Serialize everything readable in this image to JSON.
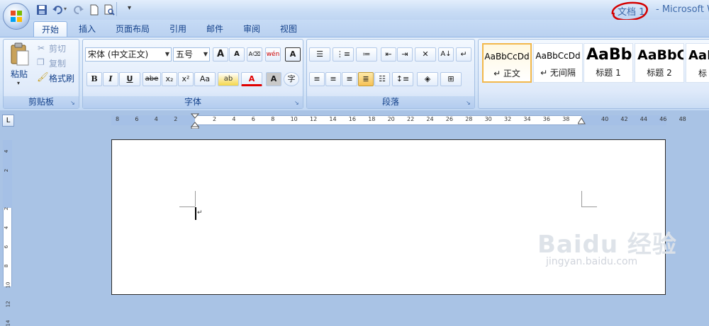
{
  "title_bar": {
    "document_name": "文档 1",
    "app_name": "- Microsoft W",
    "quick_access": [
      "save-icon",
      "undo-icon",
      "redo-icon",
      "new-icon",
      "print-preview-icon",
      "customize-qat-icon"
    ]
  },
  "tabs": [
    {
      "label": "开始",
      "active": true
    },
    {
      "label": "插入"
    },
    {
      "label": "页面布局"
    },
    {
      "label": "引用"
    },
    {
      "label": "邮件"
    },
    {
      "label": "审阅"
    },
    {
      "label": "视图"
    }
  ],
  "clipboard": {
    "paste_label": "粘贴",
    "cut_label": "剪切",
    "copy_label": "复制",
    "format_painter_label": "格式刷",
    "group_label": "剪贴板"
  },
  "font": {
    "font_name": "宋体 (中文正文)",
    "font_size": "五号",
    "grow_label": "A",
    "shrink_label": "A",
    "pinyin_label": "wén",
    "char_border_label": "A",
    "bold": "B",
    "italic": "I",
    "underline": "U",
    "strike": "abe",
    "subscript": "x₂",
    "superscript": "x²",
    "change_case": "Aa",
    "highlight": "ab",
    "font_color": "A",
    "char_shading": "A",
    "enclose": "字",
    "group_label": "字体"
  },
  "paragraph": {
    "group_label": "段落"
  },
  "styles": [
    {
      "sample": "AaBbCcDd",
      "name": "↵ 正文",
      "selected": true
    },
    {
      "sample": "AaBbCcDd",
      "name": "↵ 无间隔"
    },
    {
      "sample": "AaBb",
      "name": "标题 1"
    },
    {
      "sample": "AaBbC",
      "name": "标题 2"
    },
    {
      "sample": "AaB",
      "name": "标"
    }
  ],
  "ruler": {
    "tab_selector": "L",
    "ticks": [
      "8",
      "6",
      "4",
      "2",
      "",
      "2",
      "4",
      "6",
      "8",
      "10",
      "12",
      "14",
      "16",
      "18",
      "20",
      "22",
      "24",
      "26",
      "28",
      "30",
      "32",
      "34",
      "36",
      "38",
      "",
      "40",
      "42",
      "44",
      "46",
      "48"
    ],
    "vticks": [
      "4",
      "2",
      "",
      "2",
      "4",
      "6",
      "8",
      "10",
      "12",
      "14"
    ]
  },
  "watermark": {
    "text": "Baidu 经验",
    "url": "jingyan.baidu.com"
  },
  "colors": {
    "accent": "#15428b",
    "annotation_red": "#d40000",
    "highlight_yellow": "#f5d64a",
    "font_red": "#e00000"
  }
}
